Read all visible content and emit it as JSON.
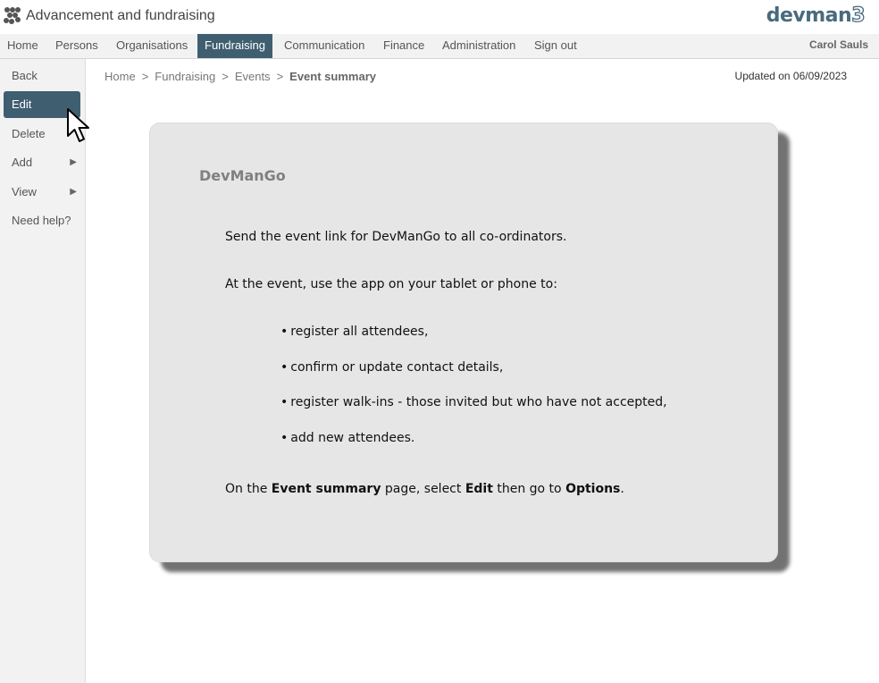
{
  "app": {
    "title": "Advancement and fundraising",
    "brand_main": "devman",
    "brand_suffix": "3",
    "accent_color": "#3f5f71"
  },
  "menu": {
    "items": [
      {
        "label": "Home"
      },
      {
        "label": "Persons"
      },
      {
        "label": "Organisations"
      },
      {
        "label": "Fundraising",
        "active": true
      },
      {
        "label": "Communication"
      },
      {
        "label": "Finance"
      },
      {
        "label": "Administration"
      },
      {
        "label": "Sign out"
      }
    ],
    "user": "Carol Sauls"
  },
  "sidebar": {
    "items": [
      {
        "label": "Back"
      },
      {
        "label": "Edit",
        "active": true
      },
      {
        "label": "Delete"
      },
      {
        "label": "Add",
        "arrow": "▶"
      },
      {
        "label": "View",
        "arrow": "▶"
      },
      {
        "label": "Need help?"
      }
    ]
  },
  "breadcrumb": {
    "items": [
      "Home",
      "Fundraising",
      "Events"
    ],
    "separator": ">",
    "current": "Event summary"
  },
  "updated": "Updated on 06/09/2023",
  "card": {
    "title": "DevManGo",
    "line1": "Send the event link for DevManGo to all co-ordinators.",
    "line2": "At the event, use the app on your tablet or phone to:",
    "bullet_char": "•",
    "bullets": [
      "register all attendees,",
      "confirm or update contact details,",
      "register walk-ins - those invited but who have not accepted,",
      "add new attendees."
    ],
    "footer": {
      "p1": "On the ",
      "b1": "Event summary",
      "p2": " page, select ",
      "b2": "Edit",
      "p3": " then go to ",
      "b3": "Options",
      "p4": "."
    }
  }
}
